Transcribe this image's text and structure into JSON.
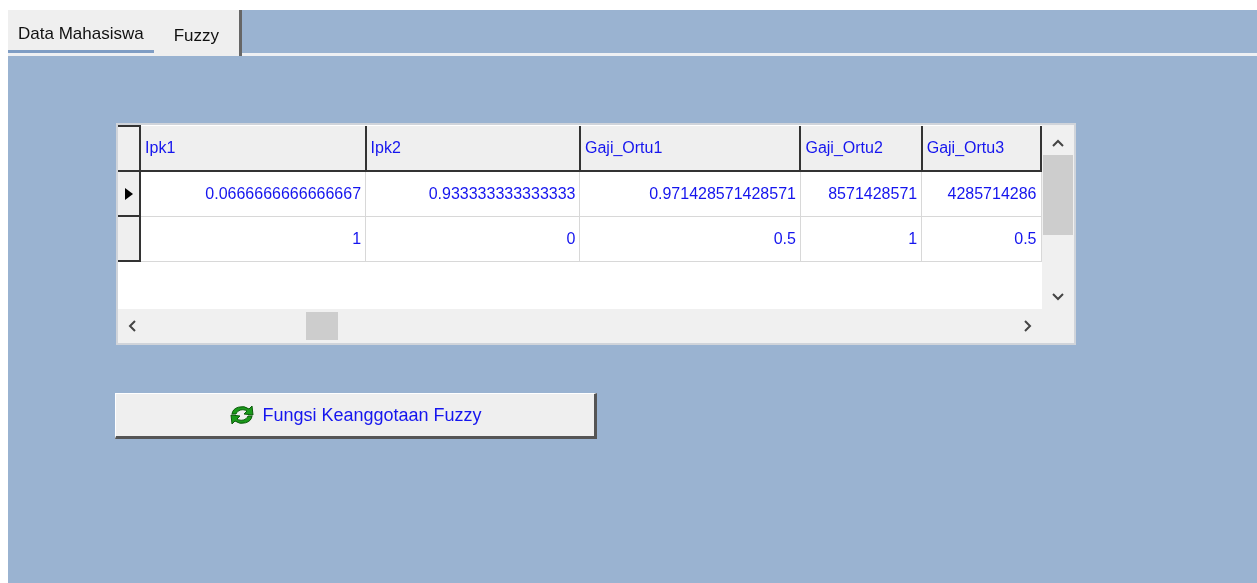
{
  "tabs": [
    {
      "label": "Data Mahasiswa",
      "selected": false
    },
    {
      "label": "Fuzzy",
      "selected": true
    }
  ],
  "grid": {
    "columns": [
      "Ipk1",
      "Ipk2",
      "Gaji_Ortu1",
      "Gaji_Ortu2",
      "Gaji_Ortu3"
    ],
    "rows": [
      {
        "current": true,
        "cells": [
          "0.0666666666666667",
          "0.933333333333333",
          "0.971428571428571",
          "8571428571",
          "4285714286"
        ]
      },
      {
        "current": false,
        "cells": [
          "1",
          "0",
          "0.5",
          "1",
          "0.5"
        ]
      }
    ]
  },
  "button": {
    "label": "Fungsi Keanggotaan Fuzzy"
  }
}
